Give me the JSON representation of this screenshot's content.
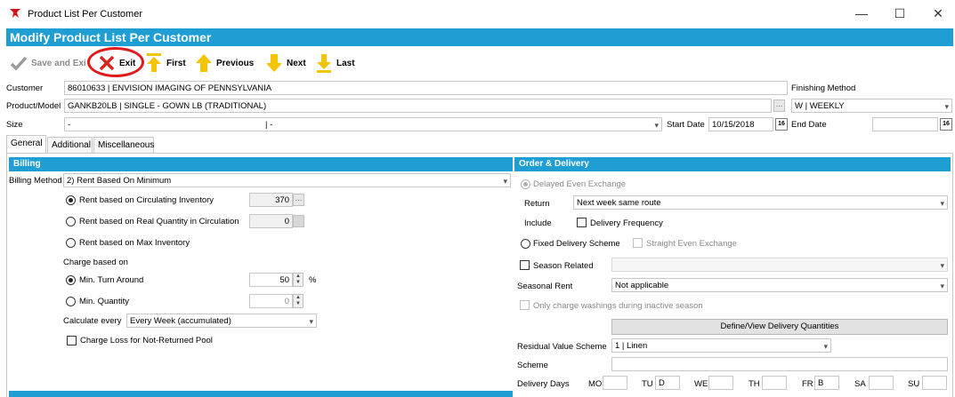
{
  "window": {
    "title": "Product List Per Customer",
    "controls": {
      "minimize": "—",
      "maximize": "☐",
      "close": "✕"
    }
  },
  "header": {
    "title": "Modify Product List Per Customer"
  },
  "toolbar": {
    "save_exit": "Save and Exit",
    "exit": "Exit",
    "first": "First",
    "previous": "Previous",
    "next": "Next",
    "last": "Last"
  },
  "form": {
    "customer_label": "Customer",
    "customer_value": "86010633      | ENVISION IMAGING OF PENNSYLVANIA",
    "product_label": "Product/Model",
    "product_value": "GANKB20LB      | SINGLE - GOWN LB (TRADITIONAL)",
    "size_label": "Size",
    "size_value_a": "-",
    "size_value_b": "| -",
    "finishing_label": "Finishing Method",
    "finishing_value": "W                  | WEEKLY",
    "start_date_label": "Start Date",
    "start_date_value": "10/15/2018",
    "end_date_label": "End Date",
    "end_date_value": "",
    "calendar_glyph": "16"
  },
  "tabs": [
    "General",
    "Additional",
    "Miscellaneous"
  ],
  "billing": {
    "title": "Billing",
    "method_label": "Billing Method",
    "method_value": "2) Rent Based On Minimum",
    "rent_circulating": "Rent based on Circulating Inventory",
    "rent_circulating_value": "370",
    "rent_real": "Rent based on Real Quantity in Circulation",
    "rent_real_value": "0",
    "rent_max": "Rent based on Max Inventory",
    "charge_based_on": "Charge based on",
    "min_turn": "Min. Turn Around",
    "min_turn_value": "50",
    "percent": "%",
    "min_qty": "Min. Quantity",
    "min_qty_value": "0",
    "calc_label": "Calculate every",
    "calc_value": "Every Week (accumulated)",
    "charge_loss": "Charge Loss for Not-Returned Pool"
  },
  "order": {
    "title": "Order & Delivery",
    "delayed": "Delayed Even Exchange",
    "return_label": "Return",
    "return_value": "Next week same route",
    "include_label": "Include",
    "delivery_freq": "Delivery Frequency",
    "fixed": "Fixed Delivery Scheme",
    "straight": "Straight Even Exchange",
    "season_related": "Season Related",
    "seasonal_rent_label": "Seasonal Rent",
    "seasonal_rent_value": "Not applicable",
    "only_charge": "Only charge washings during inactive season",
    "define_btn": "Define/View Delivery Quantities",
    "residual_label": "Residual Value Scheme",
    "residual_value": "1                               | Linen",
    "scheme_label": "Scheme",
    "delivery_days_label": "Delivery Days",
    "days": [
      {
        "code": "MO",
        "value": ""
      },
      {
        "code": "TU",
        "value": "D"
      },
      {
        "code": "WE",
        "value": ""
      },
      {
        "code": "TH",
        "value": ""
      },
      {
        "code": "FR",
        "value": "B"
      },
      {
        "code": "SA",
        "value": ""
      },
      {
        "code": "SU",
        "value": ""
      }
    ]
  },
  "colors": {
    "accent": "#1f9ed4",
    "highlight_circle": "#e01b1b",
    "arrow_yellow": "#f5c400"
  }
}
